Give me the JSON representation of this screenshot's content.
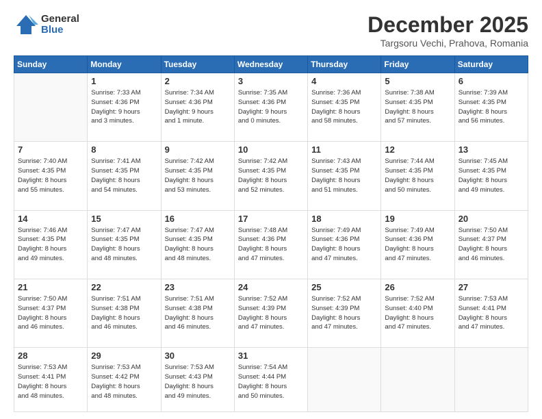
{
  "logo": {
    "general": "General",
    "blue": "Blue"
  },
  "header": {
    "title": "December 2025",
    "subtitle": "Targsoru Vechi, Prahova, Romania"
  },
  "days_of_week": [
    "Sunday",
    "Monday",
    "Tuesday",
    "Wednesday",
    "Thursday",
    "Friday",
    "Saturday"
  ],
  "weeks": [
    [
      {
        "day": "",
        "info": ""
      },
      {
        "day": "1",
        "info": "Sunrise: 7:33 AM\nSunset: 4:36 PM\nDaylight: 9 hours\nand 3 minutes."
      },
      {
        "day": "2",
        "info": "Sunrise: 7:34 AM\nSunset: 4:36 PM\nDaylight: 9 hours\nand 1 minute."
      },
      {
        "day": "3",
        "info": "Sunrise: 7:35 AM\nSunset: 4:36 PM\nDaylight: 9 hours\nand 0 minutes."
      },
      {
        "day": "4",
        "info": "Sunrise: 7:36 AM\nSunset: 4:35 PM\nDaylight: 8 hours\nand 58 minutes."
      },
      {
        "day": "5",
        "info": "Sunrise: 7:38 AM\nSunset: 4:35 PM\nDaylight: 8 hours\nand 57 minutes."
      },
      {
        "day": "6",
        "info": "Sunrise: 7:39 AM\nSunset: 4:35 PM\nDaylight: 8 hours\nand 56 minutes."
      }
    ],
    [
      {
        "day": "7",
        "info": "Sunrise: 7:40 AM\nSunset: 4:35 PM\nDaylight: 8 hours\nand 55 minutes."
      },
      {
        "day": "8",
        "info": "Sunrise: 7:41 AM\nSunset: 4:35 PM\nDaylight: 8 hours\nand 54 minutes."
      },
      {
        "day": "9",
        "info": "Sunrise: 7:42 AM\nSunset: 4:35 PM\nDaylight: 8 hours\nand 53 minutes."
      },
      {
        "day": "10",
        "info": "Sunrise: 7:42 AM\nSunset: 4:35 PM\nDaylight: 8 hours\nand 52 minutes."
      },
      {
        "day": "11",
        "info": "Sunrise: 7:43 AM\nSunset: 4:35 PM\nDaylight: 8 hours\nand 51 minutes."
      },
      {
        "day": "12",
        "info": "Sunrise: 7:44 AM\nSunset: 4:35 PM\nDaylight: 8 hours\nand 50 minutes."
      },
      {
        "day": "13",
        "info": "Sunrise: 7:45 AM\nSunset: 4:35 PM\nDaylight: 8 hours\nand 49 minutes."
      }
    ],
    [
      {
        "day": "14",
        "info": "Sunrise: 7:46 AM\nSunset: 4:35 PM\nDaylight: 8 hours\nand 49 minutes."
      },
      {
        "day": "15",
        "info": "Sunrise: 7:47 AM\nSunset: 4:35 PM\nDaylight: 8 hours\nand 48 minutes."
      },
      {
        "day": "16",
        "info": "Sunrise: 7:47 AM\nSunset: 4:35 PM\nDaylight: 8 hours\nand 48 minutes."
      },
      {
        "day": "17",
        "info": "Sunrise: 7:48 AM\nSunset: 4:36 PM\nDaylight: 8 hours\nand 47 minutes."
      },
      {
        "day": "18",
        "info": "Sunrise: 7:49 AM\nSunset: 4:36 PM\nDaylight: 8 hours\nand 47 minutes."
      },
      {
        "day": "19",
        "info": "Sunrise: 7:49 AM\nSunset: 4:36 PM\nDaylight: 8 hours\nand 47 minutes."
      },
      {
        "day": "20",
        "info": "Sunrise: 7:50 AM\nSunset: 4:37 PM\nDaylight: 8 hours\nand 46 minutes."
      }
    ],
    [
      {
        "day": "21",
        "info": "Sunrise: 7:50 AM\nSunset: 4:37 PM\nDaylight: 8 hours\nand 46 minutes."
      },
      {
        "day": "22",
        "info": "Sunrise: 7:51 AM\nSunset: 4:38 PM\nDaylight: 8 hours\nand 46 minutes."
      },
      {
        "day": "23",
        "info": "Sunrise: 7:51 AM\nSunset: 4:38 PM\nDaylight: 8 hours\nand 46 minutes."
      },
      {
        "day": "24",
        "info": "Sunrise: 7:52 AM\nSunset: 4:39 PM\nDaylight: 8 hours\nand 47 minutes."
      },
      {
        "day": "25",
        "info": "Sunrise: 7:52 AM\nSunset: 4:39 PM\nDaylight: 8 hours\nand 47 minutes."
      },
      {
        "day": "26",
        "info": "Sunrise: 7:52 AM\nSunset: 4:40 PM\nDaylight: 8 hours\nand 47 minutes."
      },
      {
        "day": "27",
        "info": "Sunrise: 7:53 AM\nSunset: 4:41 PM\nDaylight: 8 hours\nand 47 minutes."
      }
    ],
    [
      {
        "day": "28",
        "info": "Sunrise: 7:53 AM\nSunset: 4:41 PM\nDaylight: 8 hours\nand 48 minutes."
      },
      {
        "day": "29",
        "info": "Sunrise: 7:53 AM\nSunset: 4:42 PM\nDaylight: 8 hours\nand 48 minutes."
      },
      {
        "day": "30",
        "info": "Sunrise: 7:53 AM\nSunset: 4:43 PM\nDaylight: 8 hours\nand 49 minutes."
      },
      {
        "day": "31",
        "info": "Sunrise: 7:54 AM\nSunset: 4:44 PM\nDaylight: 8 hours\nand 50 minutes."
      },
      {
        "day": "",
        "info": ""
      },
      {
        "day": "",
        "info": ""
      },
      {
        "day": "",
        "info": ""
      }
    ]
  ]
}
